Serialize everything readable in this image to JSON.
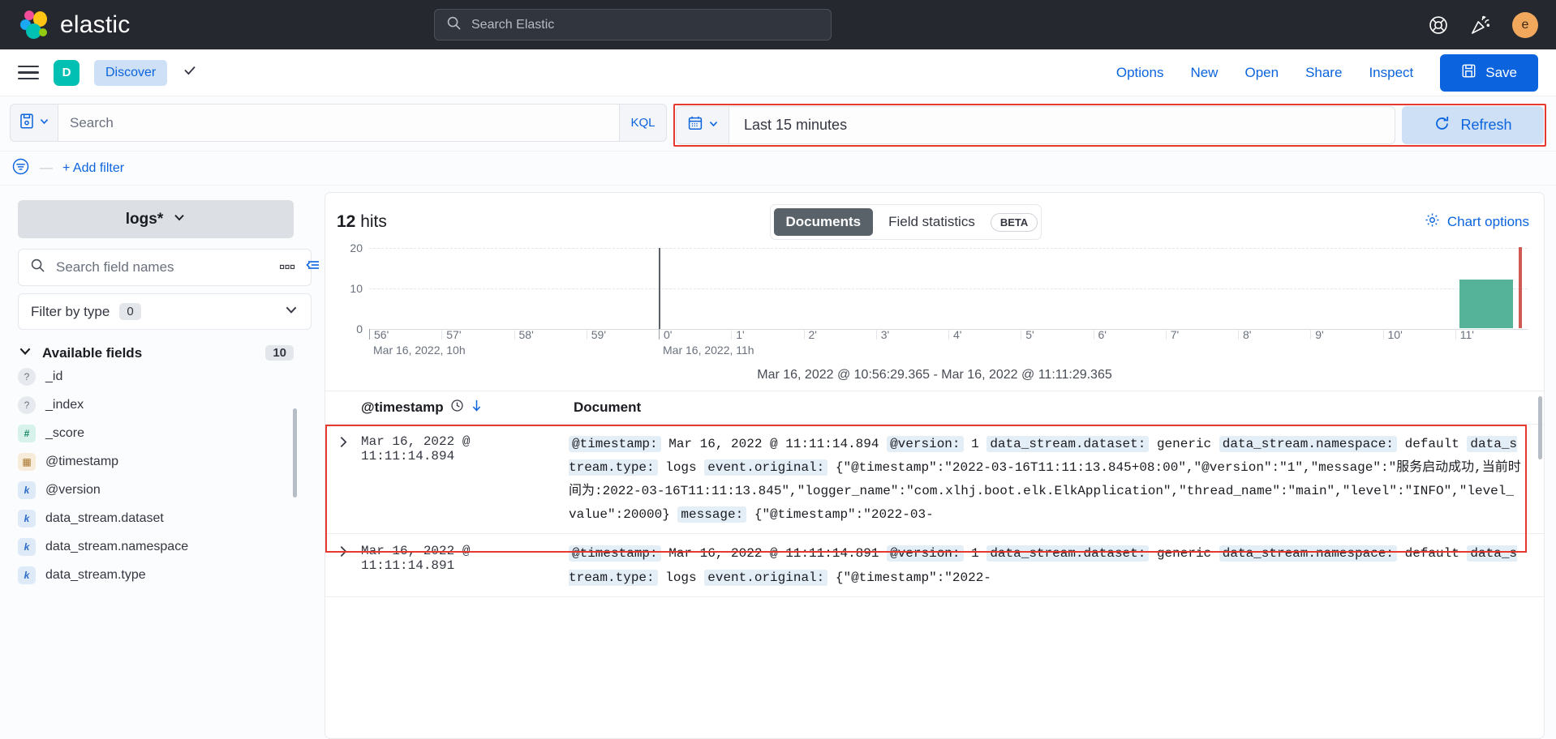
{
  "topbar": {
    "brand": "elastic",
    "search_placeholder": "Search Elastic",
    "help_icon": "help-lifebuoy-icon",
    "news_icon": "confetti-announcement-icon",
    "avatar_initial": "e"
  },
  "appnav": {
    "menu_icon": "hamburger-menu-icon",
    "app_initial": "D",
    "breadcrumb": "Discover",
    "chevron": "✓",
    "links": [
      "Options",
      "New",
      "Open",
      "Share",
      "Inspect"
    ],
    "save_label": "Save",
    "save_icon": "save-disk-icon"
  },
  "querybar": {
    "saved_query_icon": "saved-query-icon",
    "search_placeholder": "Search",
    "kql_label": "KQL",
    "calendar_icon": "calendar-icon",
    "date_range": "Last 15 minutes",
    "refresh_label": "Refresh",
    "refresh_icon": "refresh-icon"
  },
  "filterbar": {
    "filter_icon": "filter-list-icon",
    "dash": "—",
    "add_filter": "+ Add filter"
  },
  "sidebar": {
    "index_pattern": "logs*",
    "field_search_placeholder": "Search field names",
    "search_icon": "search-icon",
    "filter_by_type_label": "Filter by type",
    "filter_by_type_count": "0",
    "available_fields_label": "Available fields",
    "available_fields_count": "10",
    "fields": [
      {
        "name": "_id",
        "type": "unknown",
        "glyph": "?"
      },
      {
        "name": "_index",
        "type": "unknown",
        "glyph": "?"
      },
      {
        "name": "_score",
        "type": "number",
        "glyph": "#"
      },
      {
        "name": "@timestamp",
        "type": "date",
        "glyph": "▦"
      },
      {
        "name": "@version",
        "type": "string",
        "glyph": "k"
      },
      {
        "name": "data_stream.dataset",
        "type": "string",
        "glyph": "k"
      },
      {
        "name": "data_stream.namespace",
        "type": "string",
        "glyph": "k"
      },
      {
        "name": "data_stream.type",
        "type": "string",
        "glyph": "k"
      }
    ]
  },
  "main": {
    "collapse_icon": "collapse-sidebar-icon",
    "grid_icon": "grid-columns-icon",
    "hits_count": "12",
    "hits_label": "hits",
    "tabs": [
      {
        "label": "Documents",
        "active": true
      },
      {
        "label": "Field statistics",
        "active": false
      }
    ],
    "beta_badge": "BETA",
    "chart_options_label": "Chart options",
    "chart_options_icon": "gear-icon",
    "time_range_label": "Mar 16, 2022 @ 10:56:29.365 - Mar 16, 2022 @ 11:11:29.365",
    "table_headers": {
      "timestamp": "@timestamp",
      "clock_icon": "clock-icon",
      "sort_icon": "sort-desc-arrow-icon",
      "document": "Document"
    },
    "rows": [
      {
        "expand_icon": "chevron-right-icon",
        "timestamp": "Mar 16, 2022 @ 11:11:14.894",
        "fields": [
          {
            "key": "@timestamp:",
            "value": "Mar 16, 2022 @ 11:11:14.894"
          },
          {
            "key": "@version:",
            "value": "1"
          },
          {
            "key": "data_stream.dataset:",
            "value": "generic"
          },
          {
            "key": "data_stream.namespace:",
            "value": "default"
          },
          {
            "key": "data_stream.type:",
            "value": "logs"
          },
          {
            "key": "event.original:",
            "value": "{\"@timestamp\":\"2022-03-16T11:11:13.845+08:00\",\"@version\":\"1\",\"message\":\"服务启动成功,当前时间为:2022-03-16T11:11:13.845\",\"logger_name\":\"com.xlhj.boot.elk.ElkApplication\",\"thread_name\":\"main\",\"level\":\"INFO\",\"level_value\":20000}"
          },
          {
            "key": "message:",
            "value": "{\"@timestamp\":\"2022-03-"
          }
        ]
      },
      {
        "expand_icon": "chevron-right-icon",
        "timestamp": "Mar 16, 2022 @ 11:11:14.891",
        "fields": [
          {
            "key": "@timestamp:",
            "value": "Mar 16, 2022 @ 11:11:14.891"
          },
          {
            "key": "@version:",
            "value": "1"
          },
          {
            "key": "data_stream.dataset:",
            "value": "generic"
          },
          {
            "key": "data_stream.namespace:",
            "value": "default"
          },
          {
            "key": "data_stream.type:",
            "value": "logs"
          },
          {
            "key": "event.original:",
            "value": "{\"@timestamp\":\"2022-"
          }
        ]
      }
    ]
  },
  "chart_data": {
    "type": "bar",
    "title": "",
    "xlabel": "",
    "ylabel": "",
    "ylim": [
      0,
      20
    ],
    "yticks": [
      0,
      10,
      20
    ],
    "grid": true,
    "categories": [
      "56'",
      "57'",
      "58'",
      "59'",
      "0'",
      "1'",
      "2'",
      "3'",
      "4'",
      "5'",
      "6'",
      "7'",
      "8'",
      "9'",
      "10'",
      "11'"
    ],
    "values": [
      0,
      0,
      0,
      0,
      0,
      0,
      0,
      0,
      0,
      0,
      0,
      0,
      0,
      0,
      0,
      12
    ],
    "hour_labels": [
      {
        "at": "56'",
        "text": "Mar 16, 2022, 10h"
      },
      {
        "at": "0'",
        "text": "Mar 16, 2022, 11h"
      }
    ],
    "annotations": [
      {
        "type": "now-line",
        "color": "#cf5a53",
        "at": "11'"
      }
    ],
    "bar_color": "#54b399"
  },
  "highlights": {
    "accent_blue": "#0b64dd",
    "annotation_red": "#e8392f",
    "bar_green": "#54b399",
    "teal": "#00bfb3"
  }
}
